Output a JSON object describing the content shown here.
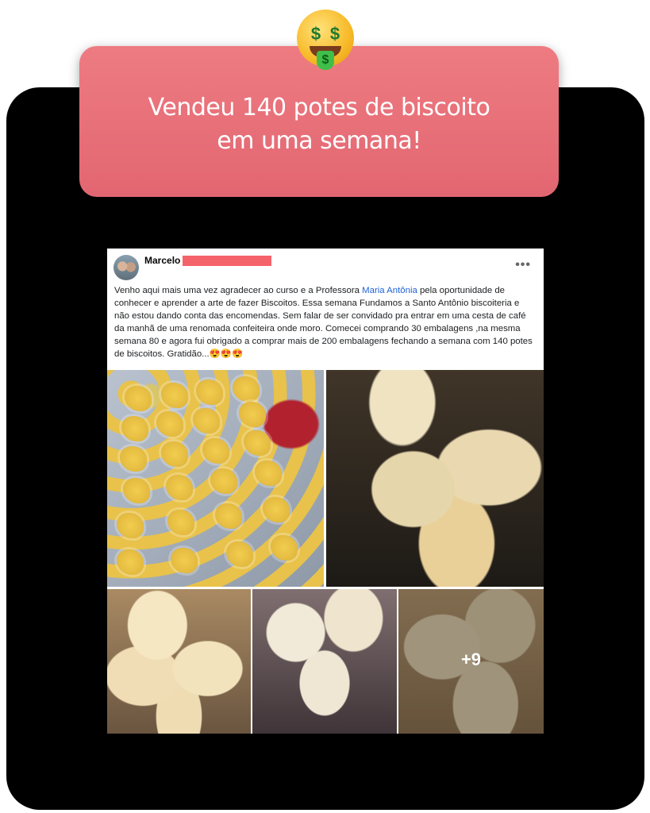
{
  "testimonial": {
    "headline_line1": "Vendeu 140 potes de biscoito",
    "headline_line2": "em uma semana!",
    "emoji_icon": "money-mouth-face",
    "banner_color": "#e76c76"
  },
  "post": {
    "author": "Marcelo",
    "more_label": "•••",
    "text_before_mention": "Venho aqui mais uma vez agradecer ao curso e a Professora ",
    "mention": "Maria Antônia",
    "text_after_mention": "  pela oportunidade de conhecer e aprender a arte de fazer Biscoitos. Essa semana Fundamos a Santo Antônio biscoiteria e não estou dando conta das encomendas. Sem falar de ser convidado pra entrar em uma cesta de café da manhã de uma renomada confeiteira  onde moro. Comecei comprando 30 embalagens ,na mesma semana 80 e agora fui obrigado a comprar mais de 200 embalagens fechando a semana com 140 potes de biscoitos. Gratidão...😍😍😍",
    "mention_color": "#1f62d6",
    "more_photos": "+9"
  }
}
